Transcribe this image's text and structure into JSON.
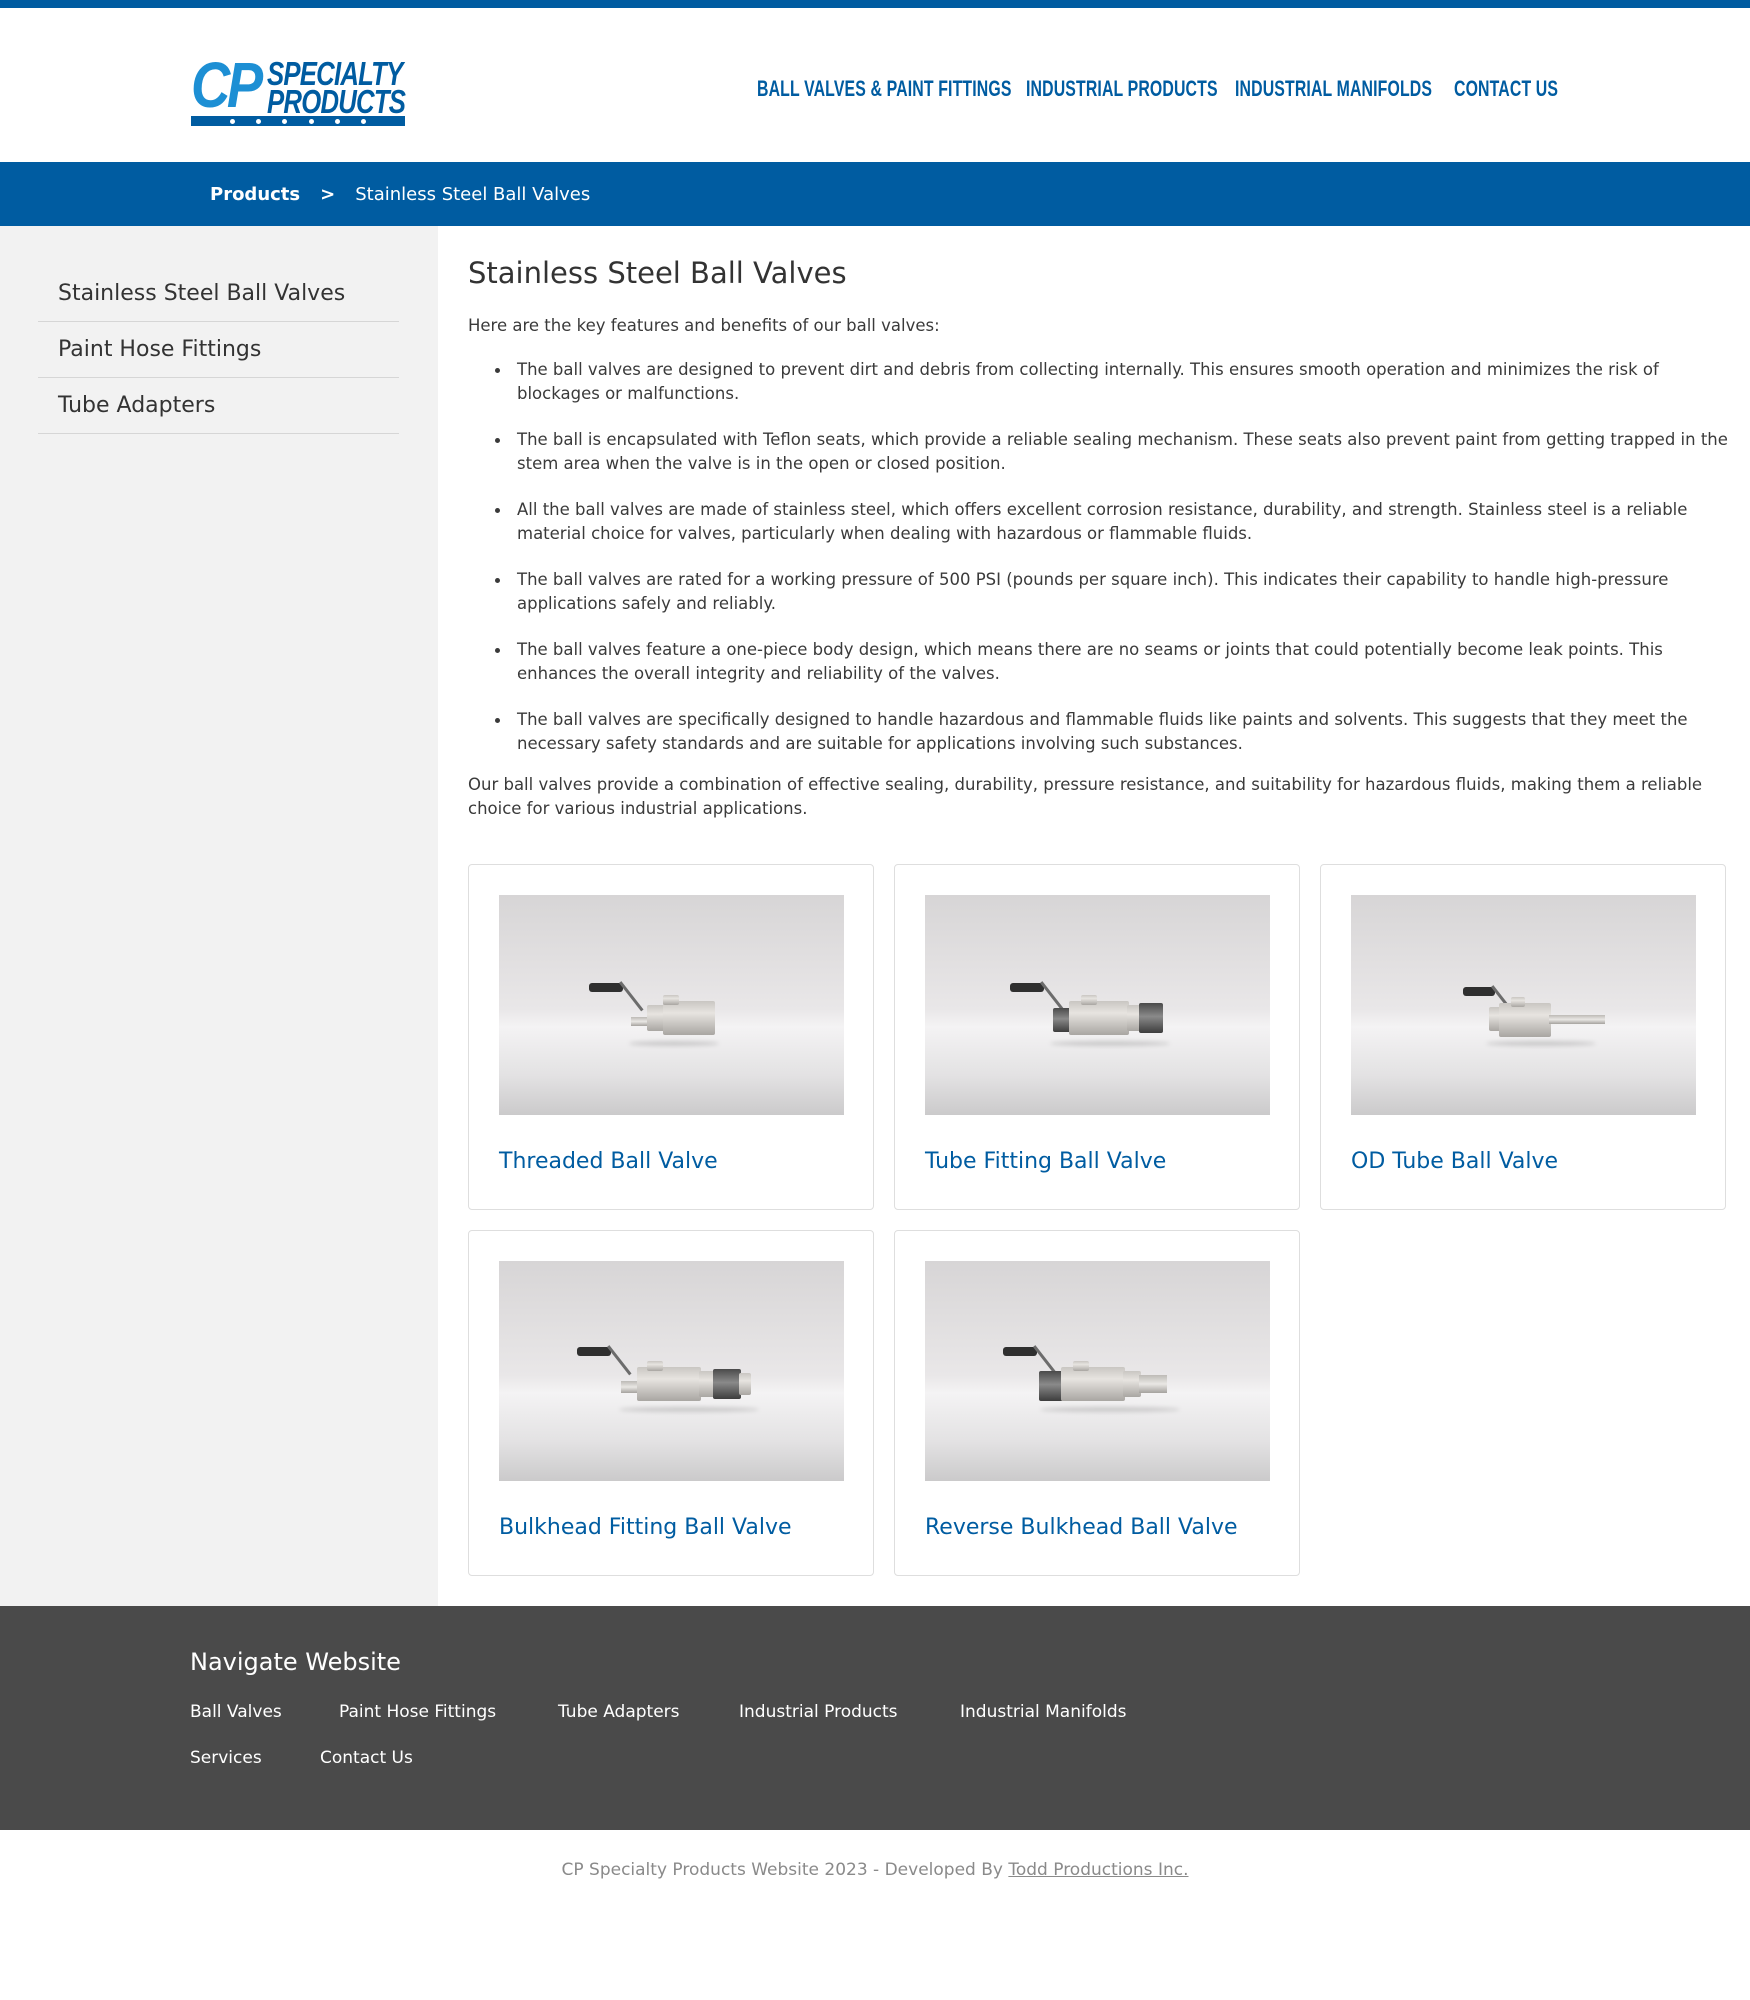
{
  "brand": {
    "logo_cp": "CP",
    "logo_line1": "SPECIALTY",
    "logo_line2": "PRODUCTS",
    "accent_color": "#005ca1",
    "logo_light_color": "#1d8fd4",
    "footer_color": "#4a4a4a",
    "sidebar_color": "#f2f2f2"
  },
  "nav": {
    "items": [
      {
        "label": "Ball Valves & Paint Fittings"
      },
      {
        "label": "Industrial Products"
      },
      {
        "label": "Industrial Manifolds"
      },
      {
        "label": "Contact Us"
      }
    ]
  },
  "breadcrumb": {
    "root": "Products",
    "separator": ">",
    "current": "Stainless Steel Ball Valves"
  },
  "sidebar": {
    "items": [
      {
        "label": "Stainless Steel Ball Valves"
      },
      {
        "label": "Paint Hose Fittings"
      },
      {
        "label": "Tube Adapters"
      }
    ]
  },
  "main": {
    "title": "Stainless Steel Ball Valves",
    "intro": "Here are the key features and benefits of our ball valves:",
    "features": [
      "The ball valves are designed to prevent dirt and debris from collecting internally. This ensures smooth operation and minimizes the risk of blockages or malfunctions.",
      "The ball is encapsulated with Teflon seats, which provide a reliable sealing mechanism. These seats also prevent paint from getting trapped in the stem area when the valve is in the open or closed position.",
      "All the ball valves are made of stainless steel, which offers excellent corrosion resistance, durability, and strength. Stainless steel is a reliable material choice for valves, particularly when dealing with hazardous or flammable fluids.",
      "The ball valves are rated for a working pressure of 500 PSI (pounds per square inch). This indicates their capability to handle high-pressure applications safely and reliably.",
      "The ball valves feature a one-piece body design, which means there are no seams or joints that could potentially become leak points. This enhances the overall integrity and reliability of the valves.",
      "The ball valves are specifically designed to handle hazardous and flammable fluids like paints and solvents. This suggests that they meet the necessary safety standards and are suitable for applications involving such substances."
    ],
    "summary": "Our ball valves provide a combination of effective sealing, durability, pressure resistance, and suitability for hazardous fluids, making them a reliable choice for various industrial applications."
  },
  "products": [
    {
      "title": "Threaded Ball Valve",
      "icon": "threaded-ball-valve-photo"
    },
    {
      "title": "Tube Fitting Ball Valve",
      "icon": "tube-fitting-ball-valve-photo"
    },
    {
      "title": "OD Tube Ball Valve",
      "icon": "od-tube-ball-valve-photo"
    },
    {
      "title": "Bulkhead Fitting Ball Valve",
      "icon": "bulkhead-fitting-ball-valve-photo"
    },
    {
      "title": "Reverse Bulkhead Ball Valve",
      "icon": "reverse-bulkhead-ball-valve-photo"
    }
  ],
  "footer": {
    "heading": "Navigate Website",
    "links": [
      {
        "label": "Ball Valves"
      },
      {
        "label": "Paint Hose Fittings"
      },
      {
        "label": "Tube Adapters"
      },
      {
        "label": "Industrial Products"
      },
      {
        "label": "Industrial Manifolds"
      },
      {
        "label": "Services"
      },
      {
        "label": "Contact Us"
      }
    ]
  },
  "copyright": {
    "text": "CP Specialty Products Website 2023 - Developed By ",
    "link": "Todd Productions Inc."
  }
}
